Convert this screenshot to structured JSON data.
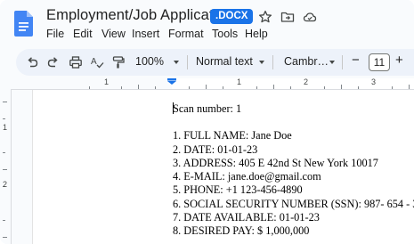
{
  "app": {
    "title": "Employment/Job Application",
    "format_badge": ".DOCX",
    "header_icons": [
      "star-icon",
      "move-to-folder-icon",
      "cloud-status-icon"
    ],
    "accent_color": "#1a73e8"
  },
  "menu": {
    "items": [
      "File",
      "Edit",
      "View",
      "Insert",
      "Format",
      "Tools",
      "Help"
    ]
  },
  "toolbar": {
    "icons": [
      "undo-icon",
      "redo-icon",
      "print-icon",
      "spellcheck-icon",
      "paint-format-icon"
    ],
    "zoom": "100%",
    "style": "Normal text",
    "font": "Cambr…",
    "font_size": "11",
    "minus": "−",
    "plus": "+"
  },
  "ruler": {
    "h_numbers": [
      "1",
      "1",
      "2",
      "3"
    ],
    "v_numbers": [
      "1",
      "2"
    ]
  },
  "document": {
    "scan_line": "Scan number: 1",
    "fields": [
      "1. FULL NAME: Jane Doe",
      "2. DATE: 01-01-23",
      "3. ADDRESS: 405 E 42nd St New York 10017",
      "4. E-MAIL: jane.doe@gmail.com",
      "5. PHONE: +1 123-456-4890",
      "6. SOCIAL SECURITY NUMBER (SSN): 987- 654 - 321",
      "7. DATE AVAILABLE: 01-01-23",
      "8. DESIRED PAY: $ 1,000,000"
    ]
  }
}
